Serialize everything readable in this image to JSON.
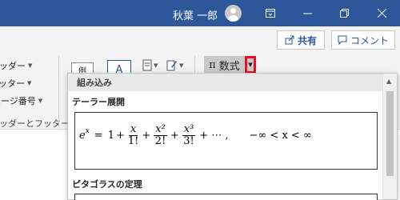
{
  "titlebar": {
    "user_name": "秋葉 一郎",
    "bg_color": "#2b579a"
  },
  "share_row": {
    "share_label": "共有",
    "comment_label": "コメント"
  },
  "ribbon": {
    "header_label": "ヘッダー",
    "footer_label": "フッター",
    "page_number_label": "ページ番号",
    "group_label": "ヘッダーとフッター",
    "example_label": "例",
    "text_box_letter": "A",
    "equation_label": "数式",
    "equation_symbol": "π"
  },
  "equation_panel": {
    "header": "組み込み",
    "sections": [
      {
        "title": "テーラー展開",
        "formula": {
          "lhs_base": "e",
          "lhs_exp": "x",
          "equals": "=",
          "one": "1",
          "plus": "+",
          "terms": [
            {
              "num": "x",
              "den": "1!"
            },
            {
              "num": "x²",
              "den": "2!"
            },
            {
              "num": "x³",
              "den": "3!"
            }
          ],
          "tail": "+ ⋯ ,",
          "range": "−∞ < x < ∞"
        }
      },
      {
        "title": "ピタゴラスの定理"
      }
    ]
  }
}
